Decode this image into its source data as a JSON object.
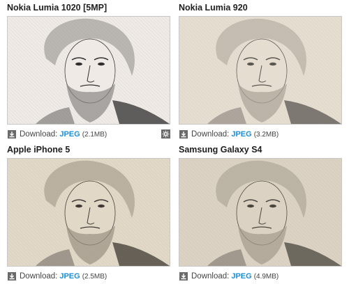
{
  "cards": [
    {
      "title": "Nokia Lumia 1020 [5MP]",
      "download_label": "Download:",
      "format": "JPEG",
      "size": "(2.1MB)",
      "has_settings": true,
      "tone": {
        "bg": "#efeae6",
        "ink": "#2e2e2e",
        "hair": "#8c8884"
      }
    },
    {
      "title": "Nokia Lumia 920",
      "download_label": "Download:",
      "format": "JPEG",
      "size": "(3.2MB)",
      "has_settings": false,
      "tone": {
        "bg": "#e6ddd1",
        "ink": "#5a5650",
        "hair": "#aaa296"
      }
    },
    {
      "title": "Apple iPhone 5",
      "download_label": "Download:",
      "format": "JPEG",
      "size": "(2.5MB)",
      "has_settings": false,
      "tone": {
        "bg": "#e2d8c8",
        "ink": "#3e3a33",
        "hair": "#9a9182"
      }
    },
    {
      "title": "Samsung Galaxy S4",
      "download_label": "Download:",
      "format": "JPEG",
      "size": "(4.9MB)",
      "has_settings": false,
      "tone": {
        "bg": "#dcd2c3",
        "ink": "#4a463e",
        "hair": "#a39a8b"
      }
    }
  ],
  "icons": {
    "download": "download-icon",
    "settings": "gear-icon"
  },
  "colors": {
    "link": "#1b8fd6",
    "icon_bg": "#6a6a6a",
    "frame_border": "#c8c8c8"
  }
}
